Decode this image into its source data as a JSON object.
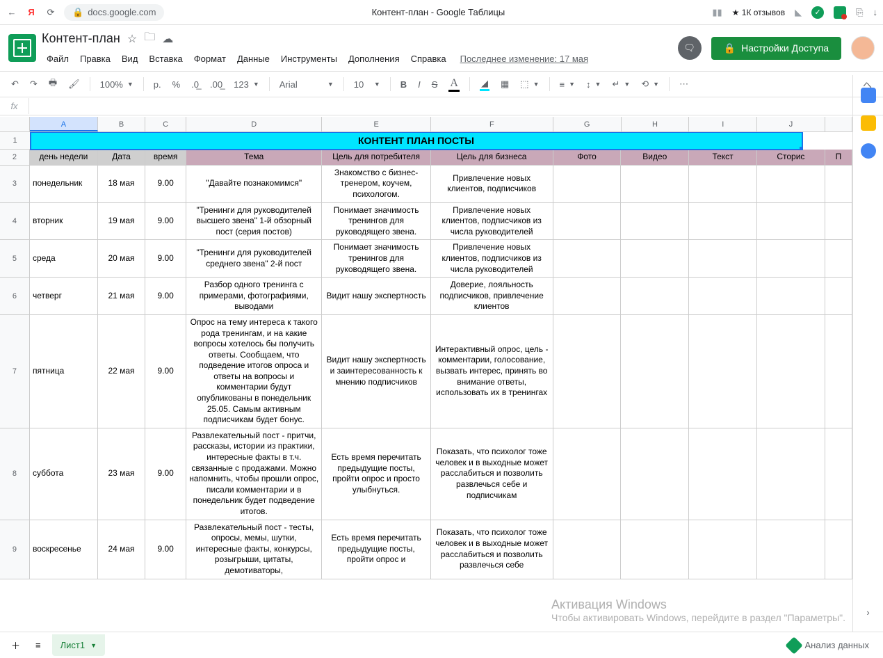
{
  "browser": {
    "url_host": "docs.google.com",
    "page_title": "Контент-план - Google Таблицы",
    "reviews": "★ 1К отзывов"
  },
  "doc": {
    "title": "Контент-план",
    "menus": [
      "Файл",
      "Правка",
      "Вид",
      "Вставка",
      "Формат",
      "Данные",
      "Инструменты",
      "Дополнения",
      "Справка"
    ],
    "last_edit": "Последнее изменение: 17 мая",
    "share_label": "Настройки Доступа"
  },
  "toolbar": {
    "zoom": "100%",
    "currency": "р.",
    "percent": "%",
    "dec_dec": ".0←",
    "dec_inc": ".00→",
    "num_fmt": "123",
    "font": "Arial",
    "size": "10"
  },
  "sheet": {
    "columns": [
      "A",
      "B",
      "C",
      "D",
      "E",
      "F",
      "G",
      "H",
      "I",
      "J"
    ],
    "col_overflow": "П",
    "title": "КОНТЕНТ ПЛАН ПОСТЫ",
    "headers": [
      "день недели",
      "Дата",
      "время",
      "Тема",
      "Цель для потребителя",
      "Цель для бизнеса",
      "Фото",
      "Видео",
      "Текст",
      "Сторис"
    ],
    "rows": [
      {
        "n": 3,
        "a": "понедельник",
        "b": "18 мая",
        "c": "9.00",
        "d": "\"Давайте познакомимся\"",
        "e": "Знакомство с бизнес-тренером, коучем, психологом.",
        "f": "Привлечение новых клиентов, подписчиков"
      },
      {
        "n": 4,
        "a": "вторник",
        "b": "19 мая",
        "c": "9.00",
        "d": "\"Тренинги для руководителей высшего звена\" 1-й обзорный пост (серия постов)",
        "e": "Понимает значимость тренингов для руководящего звена.",
        "f": "Привлечение новых клиентов, подписчиков из числа руководителей"
      },
      {
        "n": 5,
        "a": "среда",
        "b": "20 мая",
        "c": "9.00",
        "d": "\"Тренинги для руководителей среднего звена\" 2-й пост",
        "e": "Понимает значимость тренингов для руководящего звена.",
        "f": "Привлечение новых клиентов, подписчиков из числа руководителей"
      },
      {
        "n": 6,
        "a": "четверг",
        "b": "21 мая",
        "c": "9.00",
        "d": "Разбор одного тренинга с примерами, фотографиями, выводами",
        "e": "Видит нашу экспертность",
        "f": "Доверие, лояльность подписчиков, привлечение клиентов"
      },
      {
        "n": 7,
        "a": "пятница",
        "b": "22 мая",
        "c": "9.00",
        "d": "Опрос на тему интереса к такого рода тренингам, и на какие вопросы хотелось бы получить ответы.  Сообщаем, что подведение итогов опроса и ответы на вопросы и комментарии будут опубликованы в понедельник 25.05. Самым активным подписчикам будет бонус.",
        "e": "Видит нашу экспертность и заинтересованность к мнению подписчиков",
        "f": "Интерактивный опрос, цель - комментарии, голосование, вызвать интерес, принять во внимание ответы, использовать их в тренингах"
      },
      {
        "n": 8,
        "a": "суббота",
        "b": "23 мая",
        "c": "9.00",
        "d": "Развлекательный пост - притчи, рассказы, истории из практики, интересные факты в т.ч. связанные с продажами. Можно напомнить, чтобы прошли опрос, писали комментарии и в понедельник будет подведение итогов.",
        "e": "Есть время перечитать предыдущие посты, пройти опрос и просто улыбнуться.",
        "f": "Показать, что психолог тоже человек и в выходные может расслабиться и позволить развлечься себе и подписчикам"
      },
      {
        "n": 9,
        "a": "воскресенье",
        "b": "24 мая",
        "c": "9.00",
        "d": "Развлекательный пост - тесты, опросы, мемы, шутки, интересные факты, конкурсы, розыгрыши, цитаты, демотиваторы,",
        "e": "Есть время перечитать предыдущие посты, пройти опрос и",
        "f": "Показать, что психолог тоже человек и в выходные может расслабиться и позволить развлечься себе"
      }
    ],
    "tab_name": "Лист1",
    "explore": "Анализ данных"
  },
  "windows": {
    "line1": "Активация Windows",
    "line2": "Чтобы активировать Windows, перейдите в раздел \"Параметры\"."
  }
}
